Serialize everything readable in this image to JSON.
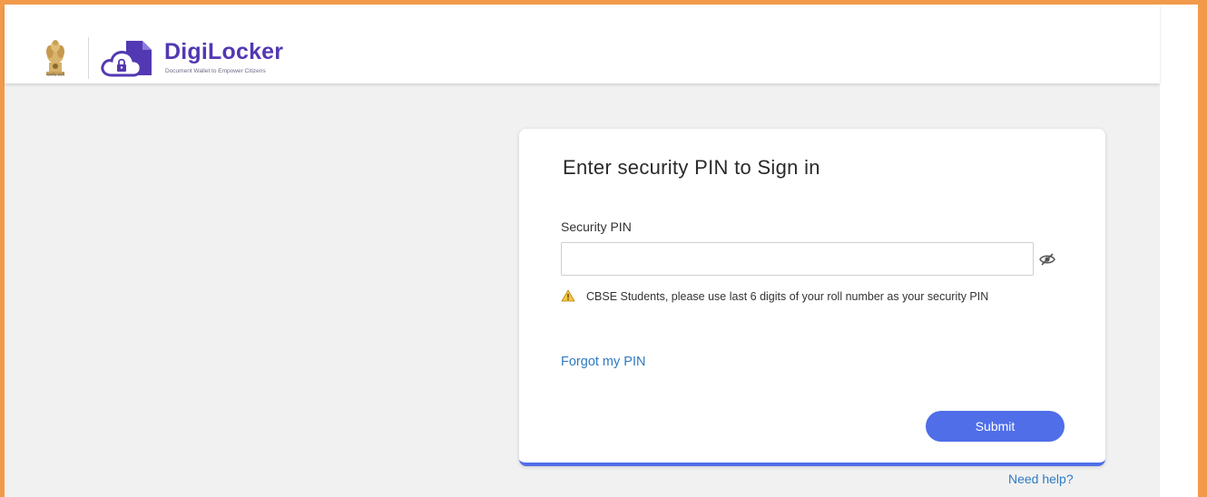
{
  "header": {
    "emblem_caption": "सत्यमेव जयते",
    "brand_name": "DigiLocker",
    "tagline": "Document Wallet to Empower Citizens",
    "brand_color": "#5338b3"
  },
  "card": {
    "title": "Enter security PIN to Sign in",
    "pin_label": "Security PIN",
    "pin_value": "",
    "pin_placeholder": "",
    "notice_text": "CBSE Students, please use last 6 digits of your roll number as your security PIN",
    "forgot_link": "Forgot my PIN",
    "submit_label": "Submit"
  },
  "help_link": "Need help?",
  "icons": {
    "warning": "warning-triangle-icon",
    "eye": "eye-slash-icon",
    "logo": "cloud-document-lock-icon",
    "emblem": "national-emblem-icon"
  },
  "colors": {
    "accent": "#4f6ee8",
    "link": "#2f7bc4",
    "frame_border": "#f29a4a",
    "background": "#f1f1f1"
  }
}
